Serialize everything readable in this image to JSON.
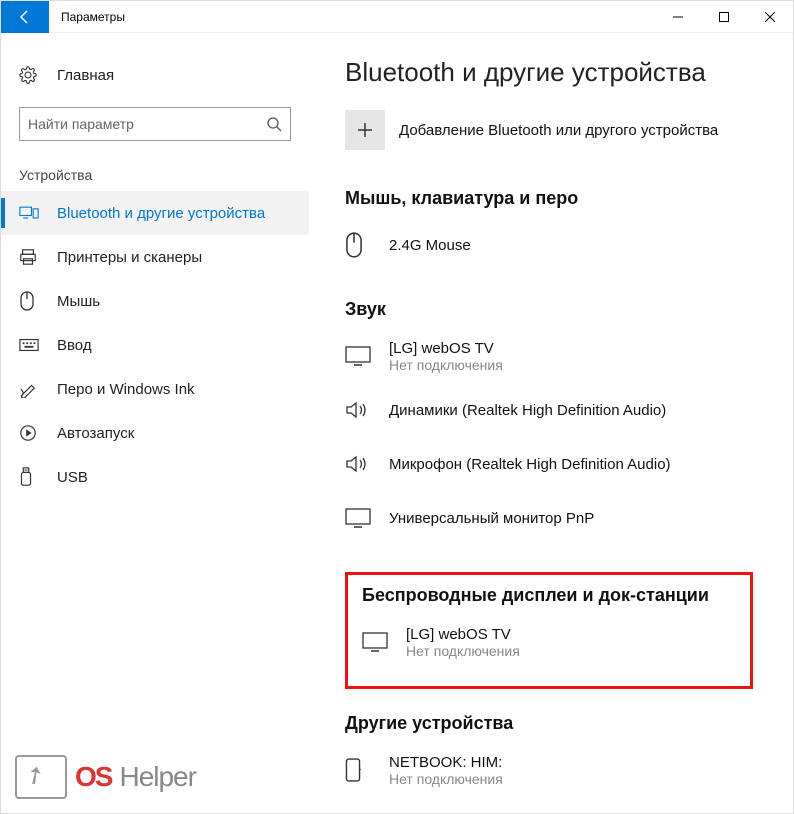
{
  "titlebar": {
    "title": "Параметры"
  },
  "sidebar": {
    "home": "Главная",
    "searchPlaceholder": "Найти параметр",
    "category": "Устройства",
    "items": [
      {
        "id": "bluetooth",
        "label": "Bluetooth и другие устройства",
        "active": true
      },
      {
        "id": "printers",
        "label": "Принтеры и сканеры"
      },
      {
        "id": "mouse",
        "label": "Мышь"
      },
      {
        "id": "typing",
        "label": "Ввод"
      },
      {
        "id": "pen",
        "label": "Перо и Windows Ink"
      },
      {
        "id": "autoplay",
        "label": "Автозапуск"
      },
      {
        "id": "usb",
        "label": "USB"
      }
    ]
  },
  "main": {
    "title": "Bluetooth и другие устройства",
    "addDevice": "Добавление Bluetooth или другого устройства",
    "sections": {
      "input": {
        "header": "Мышь, клавиатура и перо",
        "devices": [
          {
            "name": "2.4G Mouse"
          }
        ]
      },
      "audio": {
        "header": "Звук",
        "devices": [
          {
            "name": "[LG] webOS TV",
            "status": "Нет подключения"
          },
          {
            "name": "Динамики (Realtek High Definition Audio)"
          },
          {
            "name": "Микрофон (Realtek High Definition Audio)"
          },
          {
            "name": "Универсальный монитор PnP"
          }
        ]
      },
      "wireless": {
        "header": "Беспроводные дисплеи и док-станции",
        "devices": [
          {
            "name": "[LG] webOS TV",
            "status": "Нет подключения"
          }
        ]
      },
      "other": {
        "header": "Другие устройства",
        "devices": [
          {
            "name": "NETBOOK: HIM:",
            "status": "Нет подключения"
          }
        ]
      }
    }
  },
  "watermark": {
    "a": "OS",
    "b": "Helper"
  }
}
